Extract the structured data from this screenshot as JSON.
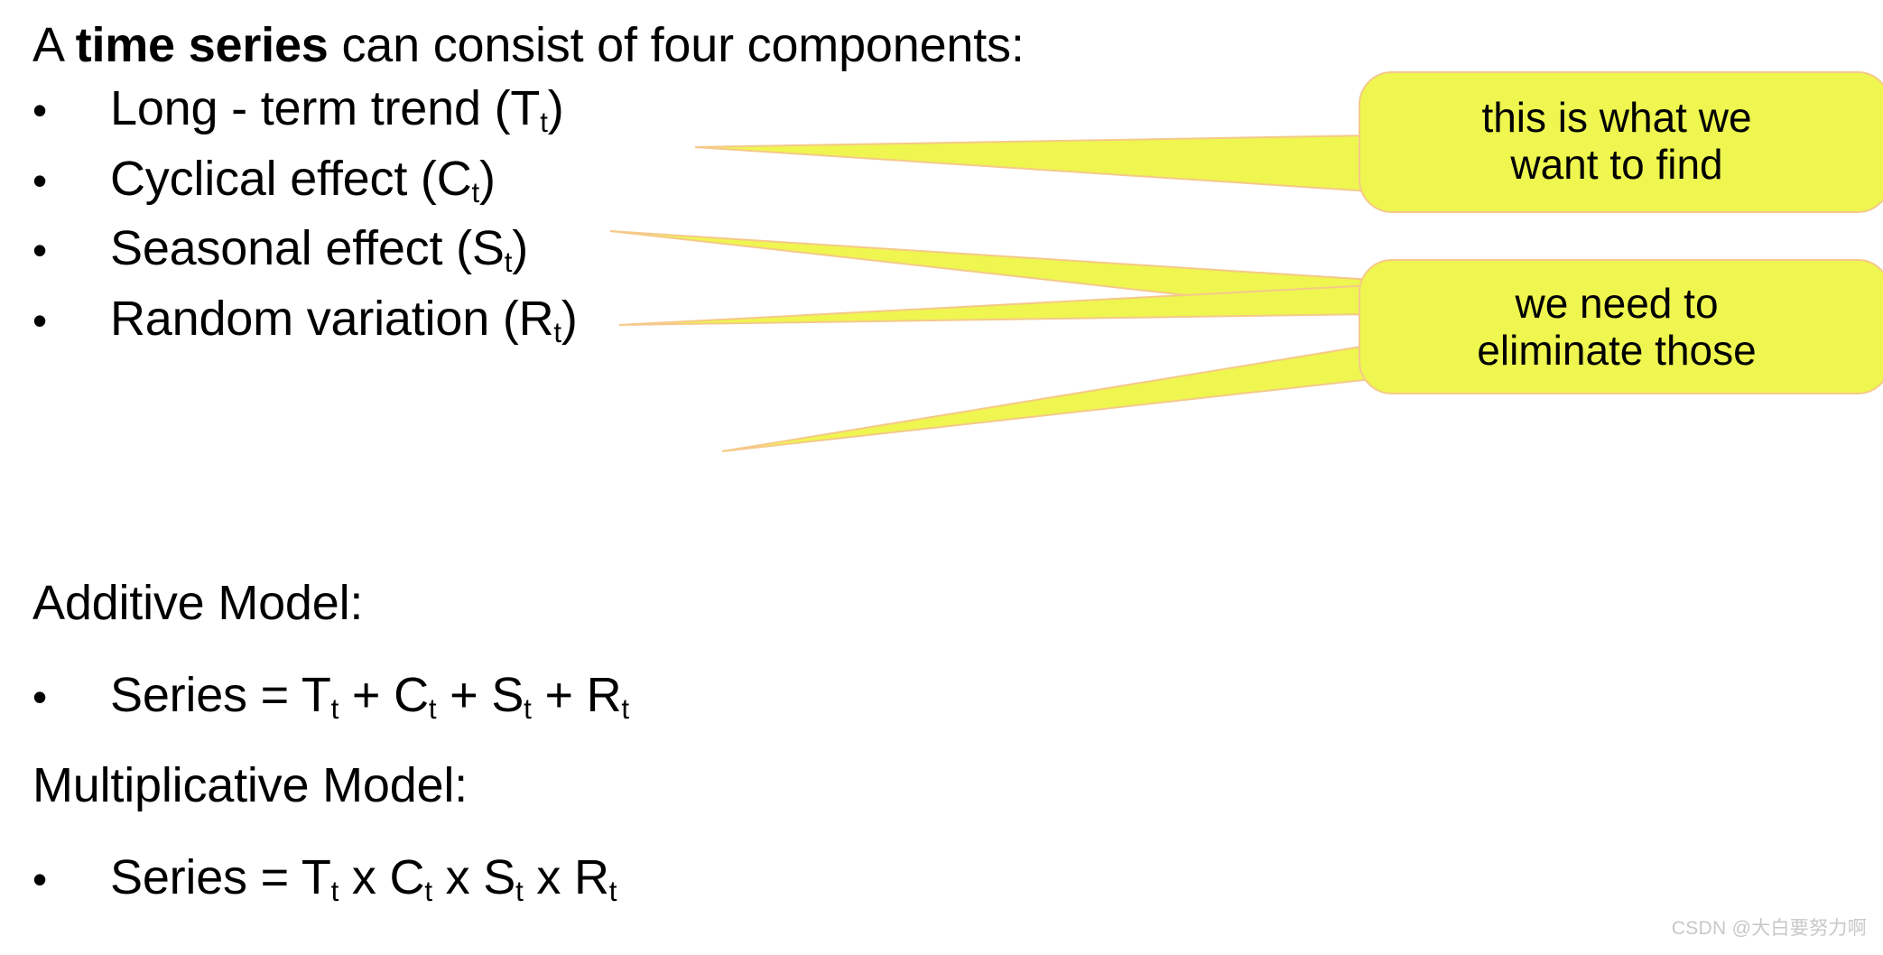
{
  "slide": {
    "title_prefix": "A ",
    "title_bold": "time series",
    "title_suffix": " can consist of four components:",
    "bullet_marker": "•",
    "components": [
      {
        "label": "Long - term trend (T",
        "sub": "t",
        "tail": ")"
      },
      {
        "label": "Cyclical effect (C",
        "sub": "t",
        "tail": ")"
      },
      {
        "label": "Seasonal effect (S",
        "sub": "t",
        "tail": ")"
      },
      {
        "label": "Random variation (R",
        "sub": "t",
        "tail": ")"
      }
    ],
    "additive_heading": "Additive Model:",
    "additive_formula_parts": [
      "Series = T",
      "t",
      " + C",
      "t",
      " + S",
      "t",
      " + R",
      "t"
    ],
    "multiplicative_heading": "Multiplicative Model:",
    "multiplicative_formula_parts": [
      "Series = T",
      "t",
      " x C",
      "t",
      " x S",
      "t",
      " x R",
      "t"
    ],
    "callouts": [
      {
        "id": "callout-want-to-find",
        "text": "this is what we\nwant to find",
        "fill": "#EEF64F",
        "stroke": "#F5C98A"
      },
      {
        "id": "callout-eliminate-those",
        "text": "we need to\neliminate those",
        "fill": "#EEF64F",
        "stroke": "#F5C98A"
      }
    ],
    "watermark": "CSDN @大白要努力啊",
    "colors": {
      "background": "#FFFFFF",
      "text": "#000000",
      "callout_fill": "#EEF64F",
      "callout_stroke": "#F5C98A",
      "watermark": "#C8C8C8"
    }
  }
}
